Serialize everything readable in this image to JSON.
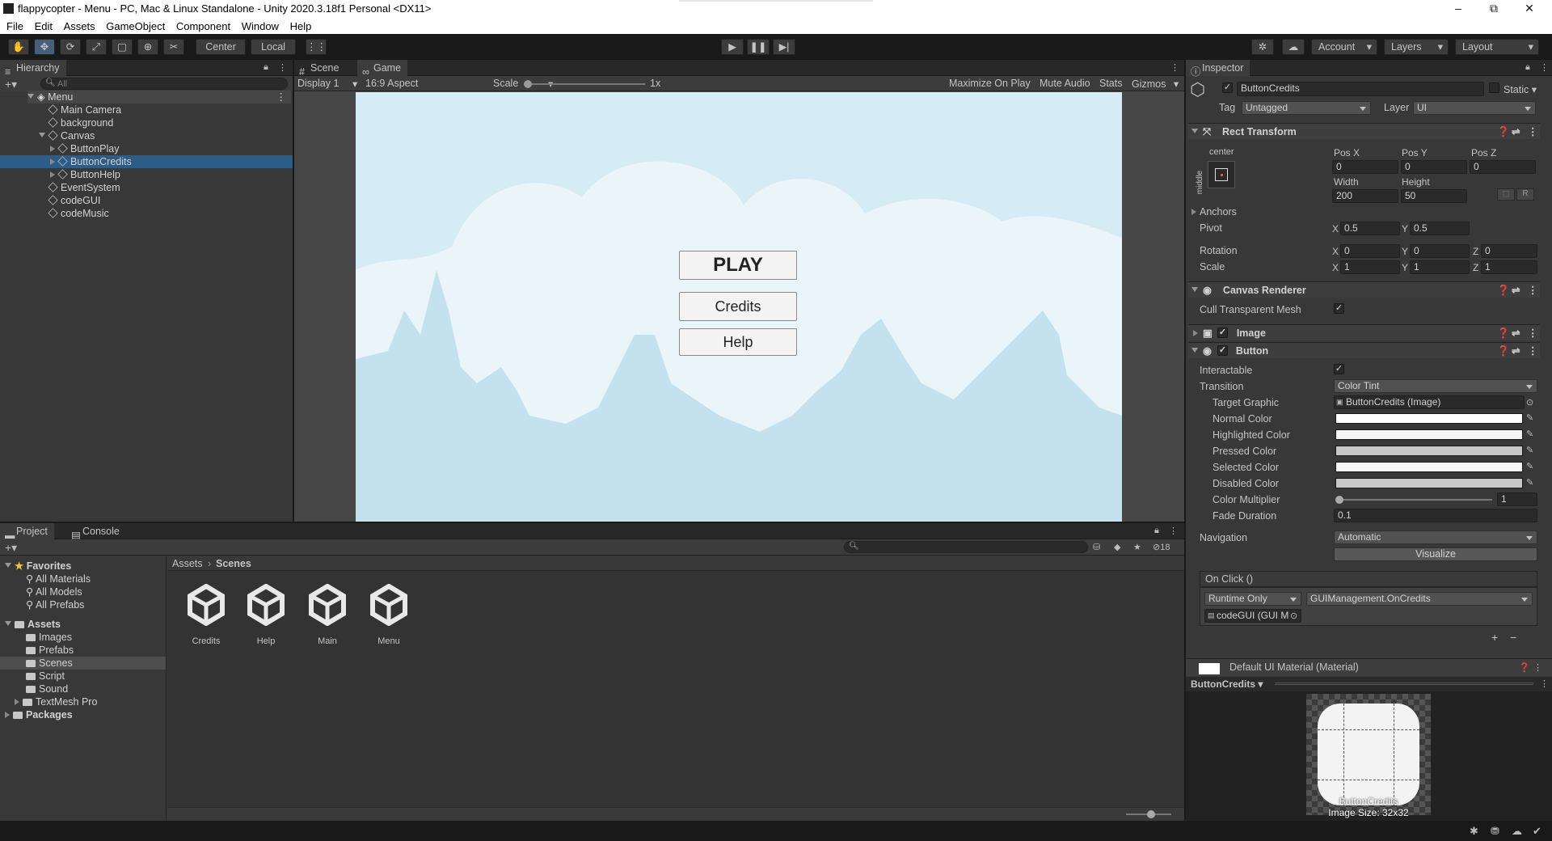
{
  "window": {
    "title": "flappycopter - Menu - PC, Mac & Linux Standalone - Unity 2020.3.18f1 Personal <DX11>",
    "minimize": "–",
    "maximize": "⧉",
    "close": "✕"
  },
  "menu": [
    "File",
    "Edit",
    "Assets",
    "GameObject",
    "Component",
    "Window",
    "Help"
  ],
  "toolbar": {
    "pivot_mode": "Center",
    "pivot_space": "Local",
    "account": "Account",
    "layers": "Layers",
    "layout": "Layout"
  },
  "hierarchy": {
    "tab": "Hierarchy",
    "search_placeholder": "All",
    "scene": "Menu",
    "items": [
      {
        "label": "Main Camera"
      },
      {
        "label": "background"
      },
      {
        "label": "Canvas"
      },
      {
        "label": "ButtonPlay"
      },
      {
        "label": "ButtonCredits"
      },
      {
        "label": "ButtonHelp"
      },
      {
        "label": "EventSystem"
      },
      {
        "label": "codeGUI"
      },
      {
        "label": "codeMusic"
      }
    ]
  },
  "game_view": {
    "tabs": [
      "Scene",
      "Game"
    ],
    "display": "Display 1",
    "aspect": "16:9 Aspect",
    "scale_label": "Scale",
    "scale_value": "1x",
    "scale_level": 0.0,
    "maximize": "Maximize On Play",
    "mute": "Mute Audio",
    "stats": "Stats",
    "gizmos": "Gizmos",
    "buttons": {
      "play": "PLAY",
      "credits": "Credits",
      "help": "Help"
    },
    "sky_color": "#d6ecf5",
    "cloud_color": "#eaf5fa",
    "mountain_color": "#c3e2ee"
  },
  "project": {
    "tabs": [
      "Project",
      "Console"
    ],
    "count": "18",
    "breadcrumb": [
      "Assets",
      "Scenes"
    ],
    "favorites_label": "Favorites",
    "favorites": [
      "All Materials",
      "All Models",
      "All Prefabs"
    ],
    "assets_label": "Assets",
    "assets": [
      "Images",
      "Prefabs",
      "Scenes",
      "Script",
      "Sound",
      "TextMesh Pro"
    ],
    "packages_label": "Packages",
    "scenes": [
      "Credits",
      "Help",
      "Main",
      "Menu"
    ]
  },
  "inspector": {
    "tab": "Inspector",
    "object_name": "ButtonCredits",
    "static": "Static",
    "tag_label": "Tag",
    "tag": "Untagged",
    "layer_label": "Layer",
    "layer": "UI",
    "rect": {
      "title": "Rect Transform",
      "anchor_h": "center",
      "anchor_v": "middle",
      "posx_label": "Pos X",
      "posy_label": "Pos Y",
      "posz_label": "Pos Z",
      "posx": "0",
      "posy": "0",
      "posz": "0",
      "width_label": "Width",
      "height_label": "Height",
      "width": "200",
      "height": "50",
      "anchors": "Anchors",
      "pivot": "Pivot",
      "pivot_x": "0.5",
      "pivot_y": "0.5",
      "rotation": "Rotation",
      "rot_x": "0",
      "rot_y": "0",
      "rot_z": "0",
      "scale": "Scale",
      "scale_x": "1",
      "scale_y": "1",
      "scale_z": "1",
      "x": "X",
      "y": "Y",
      "z": "Z",
      "r": "R"
    },
    "canvas_renderer": {
      "title": "Canvas Renderer",
      "cull": "Cull Transparent Mesh"
    },
    "image": {
      "title": "Image"
    },
    "button": {
      "title": "Button",
      "interactable": "Interactable",
      "transition_label": "Transition",
      "transition": "Color Tint",
      "target_label": "Target Graphic",
      "target": "ButtonCredits (Image)",
      "normal": "Normal Color",
      "highlighted": "Highlighted Color",
      "pressed": "Pressed Color",
      "selected": "Selected Color",
      "disabled": "Disabled Color",
      "multiplier_label": "Color Multiplier",
      "multiplier": "1",
      "fade_label": "Fade Duration",
      "fade": "0.1",
      "navigation_label": "Navigation",
      "navigation": "Automatic",
      "visualize": "Visualize",
      "onclick": "On Click ()",
      "runtime": "Runtime Only",
      "function": "GUIManagement.OnCredits",
      "object": "codeGUI (GUI M",
      "plus": "+",
      "minus": "−"
    },
    "material": "Default UI Material (Material)",
    "preview_name": "ButtonCredits",
    "preview_label": "ButtonCredits",
    "preview_size": "Image Size: 32x32"
  },
  "colors": {
    "accent": "#2c5d87",
    "normal": "#ffffff",
    "highlighted": "#f5f5f5",
    "pressed": "#c8c8c8",
    "selected": "#f5f5f5",
    "disabled": "#c8c8c8"
  }
}
